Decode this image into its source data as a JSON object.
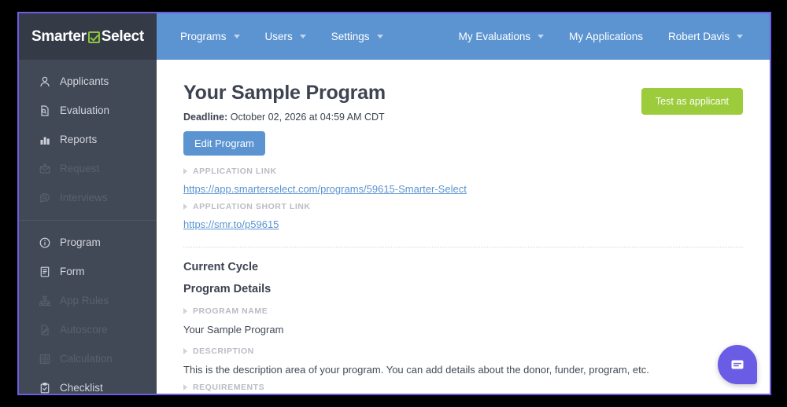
{
  "brand": {
    "name_part1": "Smarter",
    "name_part2": "Select",
    "check_icon": "checkbox-check-icon"
  },
  "topnav": {
    "left": [
      {
        "label": "Programs",
        "has_caret": true
      },
      {
        "label": "Users",
        "has_caret": true
      },
      {
        "label": "Settings",
        "has_caret": true
      }
    ],
    "right": [
      {
        "label": "My Evaluations",
        "has_caret": true
      },
      {
        "label": "My Applications",
        "has_caret": false
      },
      {
        "label": "Robert Davis",
        "has_caret": true
      }
    ]
  },
  "sidebar": {
    "group1": [
      {
        "label": "Applicants",
        "icon": "user-icon",
        "disabled": false
      },
      {
        "label": "Evaluation",
        "icon": "document-search-icon",
        "disabled": false
      },
      {
        "label": "Reports",
        "icon": "bar-chart-icon",
        "disabled": false
      },
      {
        "label": "Request",
        "icon": "envelope-icon",
        "disabled": true
      },
      {
        "label": "Interviews",
        "icon": "chat-search-icon",
        "disabled": true
      }
    ],
    "group2": [
      {
        "label": "Program",
        "icon": "info-circle-icon",
        "disabled": false
      },
      {
        "label": "Form",
        "icon": "form-document-icon",
        "disabled": false
      },
      {
        "label": "App Rules",
        "icon": "sitemap-icon",
        "disabled": true
      },
      {
        "label": "Autoscore",
        "icon": "pencil-document-icon",
        "disabled": true
      },
      {
        "label": "Calculation",
        "icon": "calculation-grid-icon",
        "disabled": true
      },
      {
        "label": "Checklist",
        "icon": "clipboard-check-icon",
        "disabled": false
      }
    ]
  },
  "main": {
    "page_title": "Your Sample Program",
    "deadline_label": "Deadline:",
    "deadline_value": " October 02, 2026 at 04:59 AM CDT",
    "edit_program_button": "Edit Program",
    "test_as_applicant_button": "Test as applicant",
    "application_link_label": "APPLICATION LINK",
    "application_link_url": "https://app.smarterselect.com/programs/59615-Smarter-Select",
    "application_short_link_label": "APPLICATION SHORT LINK",
    "application_short_link_url": "https://smr.to/p59615",
    "current_cycle_title": "Current Cycle",
    "program_details_title": "Program Details",
    "program_name_label": "PROGRAM NAME",
    "program_name_value": "Your Sample Program",
    "description_label": "DESCRIPTION",
    "description_value": "This is the description area of your program. You can add details about the donor, funder, program, etc.",
    "requirements_label": "REQUIREMENTS"
  },
  "chat": {
    "icon": "chat-bubble-icon"
  },
  "colors": {
    "nav_blue": "#5b94d1",
    "brand_dark": "#343a46",
    "sidebar": "#414856",
    "accent_green": "#9ccb3b",
    "chat_purple": "#6b5ce6",
    "window_border": "#6c5ce7",
    "link_blue": "#5b94d1",
    "heading": "#3d4351"
  }
}
